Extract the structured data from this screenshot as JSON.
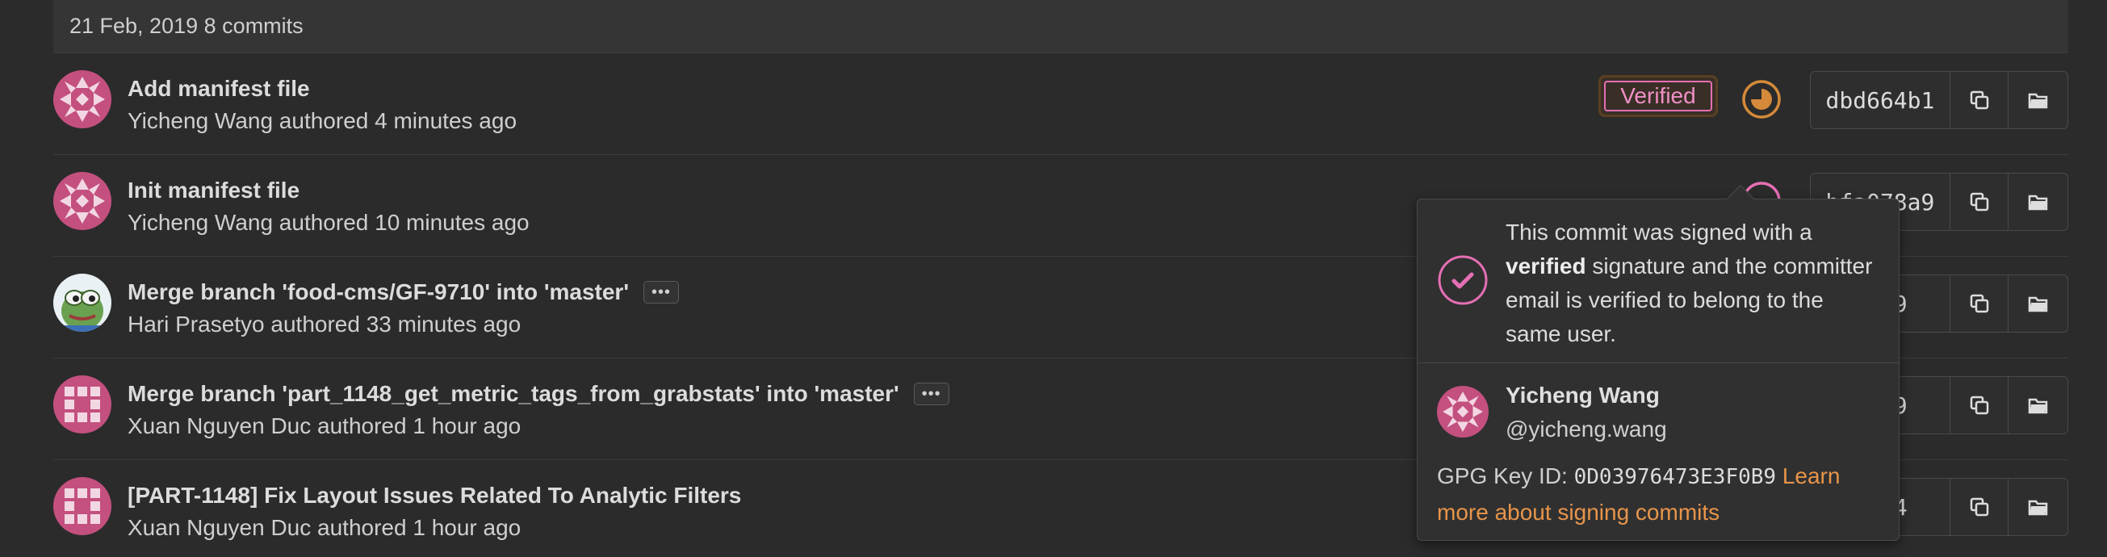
{
  "day_header": {
    "date": "21 Feb, 2019",
    "count": "8 commits"
  },
  "commits": [
    {
      "title": "Add manifest file",
      "meta": "Yicheng Wang authored 4 minutes ago",
      "sha": "dbd664b1",
      "avatar": "identicon-pink-star",
      "verified": "Verified",
      "has_ellipsis": false
    },
    {
      "title": "Init manifest file",
      "meta": "Yicheng Wang authored 10 minutes ago",
      "sha": "bfa078a9",
      "avatar": "identicon-pink-star",
      "has_ellipsis": false
    },
    {
      "title": "Merge branch 'food-cms/GF-9710' into 'master'",
      "meta": "Hari Prasetyo authored 33 minutes ago",
      "sha": "…e39",
      "avatar": "frog-avatar",
      "has_ellipsis": true
    },
    {
      "title": "Merge branch 'part_1148_get_metric_tags_from_grabstats' into 'master'",
      "meta": "Xuan Nguyen Duc authored 1 hour ago",
      "sha": "…6b9",
      "avatar": "identicon-pink-grid",
      "has_ellipsis": true
    },
    {
      "title": "[PART-1148] Fix Layout Issues Related To Analytic Filters",
      "meta": "Xuan Nguyen Duc authored 1 hour ago",
      "sha": "…354",
      "avatar": "identicon-pink-grid",
      "has_ellipsis": false
    }
  ],
  "ellipsis_label": "•••",
  "popover": {
    "line_pre": "This commit was signed with a",
    "line_bold": "verified",
    "line_post": "signature and the committer email is verified to belong to the same user.",
    "name": "Yicheng Wang",
    "username": "@yicheng.wang",
    "gpg_label": "GPG Key ID:",
    "gpg_key": "0D03976473E3F0B9",
    "learn_more": "Learn more about signing commits"
  },
  "colors": {
    "background": "#2b2b2b",
    "verified_pink": "#e56fb4",
    "pipeline_orange": "#d48a3a",
    "link_orange": "#e8954a",
    "identicon_pink": "#c4507f"
  },
  "icons": {
    "copy": "copy-icon",
    "browse": "folder-open-icon",
    "pipeline": "pipeline-running-icon",
    "check": "check-circle-icon"
  }
}
